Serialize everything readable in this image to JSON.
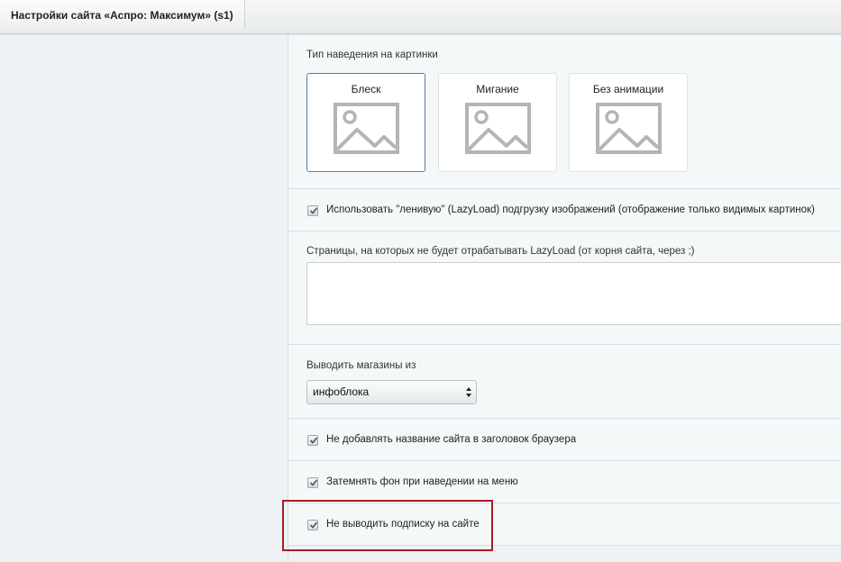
{
  "tab": {
    "title": "Настройки сайта «Аспро: Максимум» (s1)"
  },
  "hover_type": {
    "label": "Тип наведения на картинки",
    "options": [
      {
        "label": "Блеск",
        "selected": true,
        "icon": "image-placeholder-icon"
      },
      {
        "label": "Мигание",
        "selected": false,
        "icon": "image-placeholder-icon"
      },
      {
        "label": "Без анимации",
        "selected": false,
        "icon": "image-placeholder-icon"
      }
    ]
  },
  "lazyload": {
    "label": "Использовать \"ленивую\" (LazyLoad) подгрузку изображений (отображение только видимых картинок)",
    "checked": true
  },
  "lazyload_exclude": {
    "label": "Страницы, на которых не будет отрабатывать LazyLoad (от корня сайта, через ;)",
    "value": ""
  },
  "stores_source": {
    "label": "Выводить магазины из",
    "selected": "инфоблока"
  },
  "no_site_name_in_title": {
    "label": "Не добавлять название сайта в заголовок браузера",
    "checked": true
  },
  "dim_on_menu_hover": {
    "label": "Затемнять фон при наведении на меню",
    "checked": true
  },
  "hide_subscription": {
    "label": "Не выводить подписку на сайте",
    "checked": true
  },
  "colors": {
    "selected_border": "#5b7aa6",
    "highlight_border": "#a51f24",
    "placeholder_gray": "#b5b5b5"
  }
}
